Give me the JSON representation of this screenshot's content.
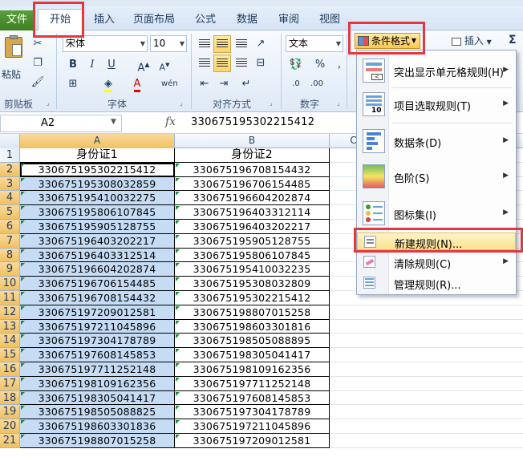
{
  "tabs": [
    "文件",
    "开始",
    "插入",
    "页面布局",
    "公式",
    "数据",
    "审阅",
    "视图"
  ],
  "ribbon": {
    "paste_label": "粘贴",
    "clipboard_label": "剪贴板",
    "font_name": "宋体",
    "font_size": "10",
    "font_group_label": "字体",
    "align_group_label": "对齐方式",
    "number_format": "文本",
    "number_group_label": "数字",
    "conditional_format_label": "条件格式",
    "insert_label": "插入",
    "sigma": "Σ"
  },
  "formula_bar": {
    "name_box": "A2",
    "fx": "fx",
    "value": "330675195302215412"
  },
  "columns": [
    "A",
    "B",
    "C"
  ],
  "rows": [
    {
      "n": "1",
      "a": "身份证1",
      "b": "身份证2"
    },
    {
      "n": "2",
      "a": "330675195302215412",
      "b": "330675196708154432"
    },
    {
      "n": "3",
      "a": "330675195308032859",
      "b": "330675196706154485"
    },
    {
      "n": "4",
      "a": "330675195410032275",
      "b": "330675196604202874"
    },
    {
      "n": "5",
      "a": "330675195806107845",
      "b": "330675196403312114"
    },
    {
      "n": "6",
      "a": "330675195905128755",
      "b": "330675196403202217"
    },
    {
      "n": "7",
      "a": "330675196403202217",
      "b": "330675195905128755"
    },
    {
      "n": "8",
      "a": "330675196403312514",
      "b": "330675195806107845"
    },
    {
      "n": "9",
      "a": "330675196604202874",
      "b": "330675195410032235"
    },
    {
      "n": "10",
      "a": "330675196706154485",
      "b": "330675195308032809"
    },
    {
      "n": "11",
      "a": "330675196708154432",
      "b": "330675195302215412"
    },
    {
      "n": "12",
      "a": "330675197209012581",
      "b": "330675198807015258"
    },
    {
      "n": "13",
      "a": "330675197211045896",
      "b": "330675198603301816"
    },
    {
      "n": "14",
      "a": "330675197304178789",
      "b": "330675198505088895"
    },
    {
      "n": "15",
      "a": "330675197608145853",
      "b": "330675198305041417"
    },
    {
      "n": "16",
      "a": "330675197711252148",
      "b": "330675198109162356"
    },
    {
      "n": "17",
      "a": "330675198109162356",
      "b": "330675197711252148"
    },
    {
      "n": "18",
      "a": "330675198305041417",
      "b": "330675197608145853"
    },
    {
      "n": "19",
      "a": "330675198505088825",
      "b": "330675197304178789"
    },
    {
      "n": "20",
      "a": "330675198603301836",
      "b": "330675197211045896"
    },
    {
      "n": "21",
      "a": "330675198807015258",
      "b": "330675197209012581"
    }
  ],
  "menu": {
    "items": [
      {
        "label": "突出显示单元格规则(H)",
        "icon": "highlight-rules-icon"
      },
      {
        "label": "项目选取规则(T)",
        "icon": "top-bottom-rules-icon"
      },
      {
        "label": "数据条(D)",
        "icon": "data-bars-icon"
      },
      {
        "label": "色阶(S)",
        "icon": "color-scales-icon"
      },
      {
        "label": "图标集(I)",
        "icon": "icon-sets-icon"
      },
      {
        "label": "新建规则(N)...",
        "icon": "new-rule-icon"
      },
      {
        "label": "清除规则(C)",
        "icon": "clear-rules-icon"
      },
      {
        "label": "管理规则(R)...",
        "icon": "manage-rules-icon"
      }
    ]
  },
  "colors": {
    "highlight_box": "#e2383f",
    "selection_fill": "#c5dcf4",
    "file_tab": "#3e7f22",
    "header_selected": "#f1c15f"
  }
}
